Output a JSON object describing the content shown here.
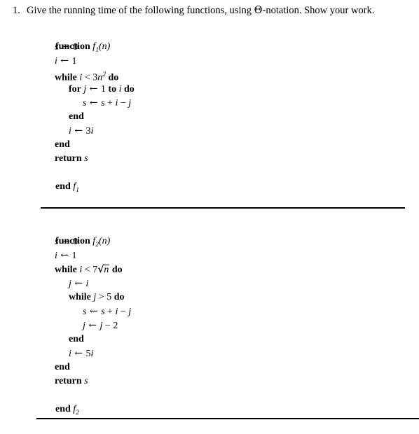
{
  "question": {
    "number": "1.",
    "text_before_symbol": "Give the running time of the following functions, using ",
    "symbol": "Θ",
    "text_after_symbol": "-notation.  Show your work."
  },
  "functions": [
    {
      "name": "f1",
      "header": {
        "keyword": "function",
        "fname": "f",
        "subscript": "1",
        "params": "(n)"
      },
      "lines": [
        {
          "indent": 1,
          "parts": [
            {
              "t": "var",
              "v": "s"
            },
            {
              "t": "arrow",
              "v": " ← "
            },
            {
              "t": "num",
              "v": "0"
            }
          ]
        },
        {
          "indent": 1,
          "parts": [
            {
              "t": "var",
              "v": "i"
            },
            {
              "t": "arrow",
              "v": " ← "
            },
            {
              "t": "num",
              "v": "1"
            }
          ]
        },
        {
          "indent": 1,
          "parts": [
            {
              "t": "kw",
              "v": "while"
            },
            {
              "t": "plain",
              "v": " "
            },
            {
              "t": "var",
              "v": "i"
            },
            {
              "t": "op",
              "v": " < "
            },
            {
              "t": "num",
              "v": "3"
            },
            {
              "t": "var",
              "v": "n"
            },
            {
              "t": "sup",
              "v": "2"
            },
            {
              "t": "plain",
              "v": " "
            },
            {
              "t": "kw",
              "v": "do"
            }
          ]
        },
        {
          "indent": 2,
          "parts": [
            {
              "t": "kw",
              "v": "for"
            },
            {
              "t": "plain",
              "v": " "
            },
            {
              "t": "var",
              "v": "j"
            },
            {
              "t": "arrow",
              "v": " ← "
            },
            {
              "t": "num",
              "v": "1"
            },
            {
              "t": "plain",
              "v": " "
            },
            {
              "t": "kw",
              "v": "to"
            },
            {
              "t": "plain",
              "v": " "
            },
            {
              "t": "var",
              "v": "i"
            },
            {
              "t": "plain",
              "v": " "
            },
            {
              "t": "kw",
              "v": "do"
            }
          ]
        },
        {
          "indent": 3,
          "parts": [
            {
              "t": "var",
              "v": "s"
            },
            {
              "t": "arrow",
              "v": " ← "
            },
            {
              "t": "var",
              "v": "s"
            },
            {
              "t": "op",
              "v": " + "
            },
            {
              "t": "var",
              "v": "i"
            },
            {
              "t": "op",
              "v": " − "
            },
            {
              "t": "var",
              "v": "j"
            }
          ]
        },
        {
          "indent": 2,
          "parts": [
            {
              "t": "kw",
              "v": "end"
            }
          ]
        },
        {
          "indent": 2,
          "parts": [
            {
              "t": "var",
              "v": "i"
            },
            {
              "t": "arrow",
              "v": " ← "
            },
            {
              "t": "num",
              "v": "3"
            },
            {
              "t": "var",
              "v": "i"
            }
          ]
        },
        {
          "indent": 1,
          "parts": [
            {
              "t": "kw",
              "v": "end"
            }
          ]
        },
        {
          "indent": 1,
          "parts": [
            {
              "t": "kw",
              "v": "return"
            },
            {
              "t": "plain",
              "v": " "
            },
            {
              "t": "var",
              "v": "s"
            }
          ]
        }
      ],
      "footer": {
        "keyword": "end",
        "fname": "f",
        "subscript": "1"
      }
    },
    {
      "name": "f2",
      "header": {
        "keyword": "function",
        "fname": "f",
        "subscript": "2",
        "params": "(n)"
      },
      "lines": [
        {
          "indent": 1,
          "parts": [
            {
              "t": "var",
              "v": "s"
            },
            {
              "t": "arrow",
              "v": " ← "
            },
            {
              "t": "num",
              "v": "0"
            }
          ]
        },
        {
          "indent": 1,
          "parts": [
            {
              "t": "var",
              "v": "i"
            },
            {
              "t": "arrow",
              "v": " ← "
            },
            {
              "t": "num",
              "v": "1"
            }
          ]
        },
        {
          "indent": 1,
          "parts": [
            {
              "t": "kw",
              "v": "while"
            },
            {
              "t": "plain",
              "v": " "
            },
            {
              "t": "var",
              "v": "i"
            },
            {
              "t": "op",
              "v": " < "
            },
            {
              "t": "num",
              "v": "7"
            },
            {
              "t": "sqrt",
              "v": "n"
            },
            {
              "t": "plain",
              "v": " "
            },
            {
              "t": "kw",
              "v": "do"
            }
          ]
        },
        {
          "indent": 2,
          "parts": [
            {
              "t": "var",
              "v": "j"
            },
            {
              "t": "arrow",
              "v": " ← "
            },
            {
              "t": "var",
              "v": "i"
            }
          ]
        },
        {
          "indent": 2,
          "parts": [
            {
              "t": "kw",
              "v": "while"
            },
            {
              "t": "plain",
              "v": " "
            },
            {
              "t": "var",
              "v": "j"
            },
            {
              "t": "op",
              "v": " > "
            },
            {
              "t": "num",
              "v": "5"
            },
            {
              "t": "plain",
              "v": " "
            },
            {
              "t": "kw",
              "v": "do"
            }
          ]
        },
        {
          "indent": 3,
          "parts": [
            {
              "t": "var",
              "v": "s"
            },
            {
              "t": "arrow",
              "v": " ← "
            },
            {
              "t": "var",
              "v": "s"
            },
            {
              "t": "op",
              "v": " + "
            },
            {
              "t": "var",
              "v": "i"
            },
            {
              "t": "op",
              "v": " − "
            },
            {
              "t": "var",
              "v": "j"
            }
          ]
        },
        {
          "indent": 3,
          "parts": [
            {
              "t": "var",
              "v": "j"
            },
            {
              "t": "arrow",
              "v": " ← "
            },
            {
              "t": "var",
              "v": "j"
            },
            {
              "t": "op",
              "v": " − "
            },
            {
              "t": "num",
              "v": "2"
            }
          ]
        },
        {
          "indent": 2,
          "parts": [
            {
              "t": "kw",
              "v": "end"
            }
          ]
        },
        {
          "indent": 2,
          "parts": [
            {
              "t": "var",
              "v": "i"
            },
            {
              "t": "arrow",
              "v": " ← "
            },
            {
              "t": "num",
              "v": "5"
            },
            {
              "t": "var",
              "v": "i"
            }
          ]
        },
        {
          "indent": 1,
          "parts": [
            {
              "t": "kw",
              "v": "end"
            }
          ]
        },
        {
          "indent": 1,
          "parts": [
            {
              "t": "kw",
              "v": "return"
            },
            {
              "t": "plain",
              "v": " "
            },
            {
              "t": "var",
              "v": "s"
            }
          ]
        }
      ],
      "footer": {
        "keyword": "end",
        "fname": "f",
        "subscript": "2"
      }
    }
  ],
  "dividers": [
    {
      "name": "divider-between-functions"
    },
    {
      "name": "divider-bottom"
    }
  ],
  "colors": {
    "text": "#000000",
    "background": "#ffffff",
    "rule": "#000000"
  }
}
